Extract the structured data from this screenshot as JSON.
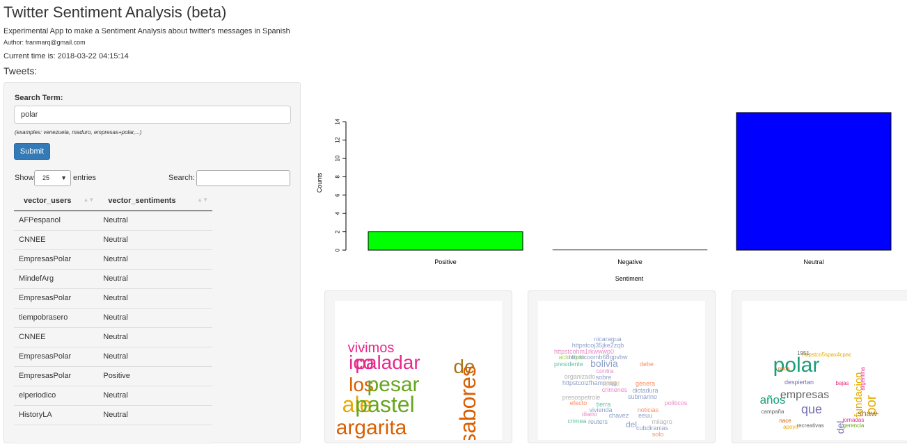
{
  "app": {
    "title": "Twitter Sentiment Analysis (beta)",
    "subtitle": "Experimental App to make a Sentiment Analysis about twitter's messages in Spanish",
    "author": "Author: franmarq@gmail.com",
    "current_time": "Current time is: 2018-03-22 04:15:14",
    "tweets_label": "Tweets:"
  },
  "search": {
    "label": "Search Term:",
    "value": "polar",
    "examples": "(examples: venezuela, maduro, empresas+polar,...)",
    "submit_label": "Submit"
  },
  "table": {
    "show_label": "Show",
    "length_value": "25",
    "entries_label": "entries",
    "search_label": "Search:",
    "columns": [
      "vector_users",
      "vector_sentiments"
    ],
    "rows": [
      [
        "AFPespanol",
        "Neutral"
      ],
      [
        "CNNEE",
        "Neutral"
      ],
      [
        "EmpresasPolar",
        "Neutral"
      ],
      [
        "MindefArg",
        "Neutral"
      ],
      [
        "EmpresasPolar",
        "Neutral"
      ],
      [
        "tiempobrasero",
        "Neutral"
      ],
      [
        "CNNEE",
        "Neutral"
      ],
      [
        "EmpresasPolar",
        "Neutral"
      ],
      [
        "EmpresasPolar",
        "Positive"
      ],
      [
        "elperiodico",
        "Neutral"
      ],
      [
        "HistoryLA",
        "Neutral"
      ],
      [
        "",
        ""
      ]
    ]
  },
  "chart_data": {
    "type": "bar",
    "categories": [
      "Positive",
      "Negative",
      "Neutral"
    ],
    "values": [
      2,
      0,
      15
    ],
    "colors": [
      "#00ff00",
      "#ff0000",
      "#0000ff"
    ],
    "xlabel": "Sentiment",
    "ylabel": "Counts",
    "yticks": [
      0,
      2,
      4,
      6,
      8,
      10,
      12,
      14
    ],
    "ylim": [
      0,
      15
    ]
  },
  "wordclouds": [
    {
      "words": [
        {
          "text": "vivimos",
          "color": "#e7298a"
        },
        {
          "text": "...",
          "color": "#1b9e77"
        },
        {
          "text": "ico",
          "color": "#e7298a"
        },
        {
          "text": "paladar",
          "color": "#e7298a"
        },
        {
          "text": "de",
          "color": "#a6761d"
        },
        {
          "text": "los",
          "color": "#d95f02"
        },
        {
          "text": "pesar",
          "color": "#66a61e"
        },
        {
          "text": "sabores",
          "color": "#d95f02"
        },
        {
          "text": "ale",
          "color": "#e6ab02"
        },
        {
          "text": "pastel",
          "color": "#66a61e"
        },
        {
          "text": "margarita",
          "color": "#d95f02"
        }
      ]
    },
    {
      "words": [
        {
          "text": "nicaragua",
          "color": "#8da0cb"
        },
        {
          "text": "httpstcoj35jke2zqb",
          "color": "#8da0cb"
        },
        {
          "text": "httpstcohm1rkwwwp0",
          "color": "#e78ac3"
        },
        {
          "text": "actuando",
          "color": "#a6d854"
        },
        {
          "text": "httpstcoomb68gpvbw",
          "color": "#8da0cb"
        },
        {
          "text": "presidente",
          "color": "#66c2a5"
        },
        {
          "text": "bolivia",
          "color": "#8da0cb"
        },
        {
          "text": "debe",
          "color": "#fc8d62"
        },
        {
          "text": "contra",
          "color": "#e78ac3"
        },
        {
          "text": "organizado",
          "color": "#b3b3b3"
        },
        {
          "text": "sobre",
          "color": "#8da0cb"
        },
        {
          "text": "httpstcolzfhampnqg",
          "color": "#8da0cb"
        },
        {
          "text": "usted",
          "color": "#e5c494"
        },
        {
          "text": "genera",
          "color": "#fc8d62"
        },
        {
          "text": "crimenes",
          "color": "#e78ac3"
        },
        {
          "text": "dictadura",
          "color": "#8da0cb"
        },
        {
          "text": "presospetrole",
          "color": "#b3b3b3"
        },
        {
          "text": "efecto",
          "color": "#fc8d62"
        },
        {
          "text": "tierra",
          "color": "#66c2a5"
        },
        {
          "text": "submarino",
          "color": "#8da0cb"
        },
        {
          "text": "vivienda",
          "color": "#8da0cb"
        },
        {
          "text": "noticias",
          "color": "#fc8d62"
        },
        {
          "text": "politicos",
          "color": "#e78ac3"
        },
        {
          "text": "diario",
          "color": "#e78ac3"
        },
        {
          "text": "chavez",
          "color": "#8da0cb"
        },
        {
          "text": "eeuu",
          "color": "#8da0cb"
        },
        {
          "text": "milagro",
          "color": "#b3b3b3"
        },
        {
          "text": "reuters",
          "color": "#8da0cb"
        },
        {
          "text": "crimea",
          "color": "#66c2a5"
        },
        {
          "text": "del",
          "color": "#8da0cb"
        },
        {
          "text": "cubdiranias",
          "color": "#8da0cb"
        },
        {
          "text": "solo",
          "color": "#fc8d62"
        }
      ]
    },
    {
      "words": [
        {
          "text": "httpstco5spax4cpac",
          "color": "#e6ab02"
        },
        {
          "text": "polar",
          "color": "#1b9e77"
        },
        {
          "text": "1951",
          "color": "#666666"
        },
        {
          "text": "osos",
          "color": "#d95f02"
        },
        {
          "text": "despiertan",
          "color": "#7570b3"
        },
        {
          "text": "bajas",
          "color": "#e7298a"
        },
        {
          "text": "argentina",
          "color": "#e7298a"
        },
        {
          "text": "fundacion",
          "color": "#e6ab02"
        },
        {
          "text": "empresas",
          "color": "#666666"
        },
        {
          "text": "que",
          "color": "#7570b3"
        },
        {
          "text": "por",
          "color": "#e6ab02"
        },
        {
          "text": "años",
          "color": "#1b9e77"
        },
        {
          "text": "shaw",
          "color": "#a6761d"
        },
        {
          "text": "del",
          "color": "#7570b3"
        },
        {
          "text": "jornadas",
          "color": "#e7298a"
        },
        {
          "text": "gerencia",
          "color": "#66a61e"
        },
        {
          "text": "recreativas",
          "color": "#666666"
        },
        {
          "text": "campaña",
          "color": "#666666"
        },
        {
          "text": "nace",
          "color": "#d95f02"
        },
        {
          "text": "apoyo",
          "color": "#e6ab02"
        }
      ]
    }
  ]
}
